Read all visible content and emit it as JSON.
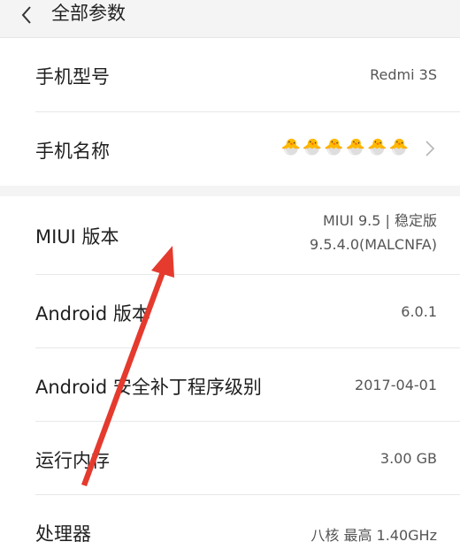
{
  "header": {
    "title": "全部参数"
  },
  "rows": [
    {
      "label": "手机型号",
      "value": "Redmi 3S"
    },
    {
      "label": "手机名称",
      "value": "🐣🐣🐣🐣🐣🐣"
    },
    {
      "label": "MIUI 版本",
      "value_line1": "MIUI 9.5 | 稳定版",
      "value_line2": "9.5.4.0(MALCNFA)"
    },
    {
      "label": "Android 版本",
      "value": "6.0.1"
    },
    {
      "label": "Android 安全补丁程序级别",
      "value": "2017-04-01"
    },
    {
      "label": "运行内存",
      "value": "3.00 GB"
    },
    {
      "label": "处理器",
      "value": "八核 最高 1.40GHz"
    }
  ],
  "colors": {
    "annotation_arrow": "#e53a2e",
    "header_background": "#f4f4f4"
  },
  "icons": {
    "back": "chevron-left-icon",
    "row_chevron": "chevron-right-icon"
  }
}
